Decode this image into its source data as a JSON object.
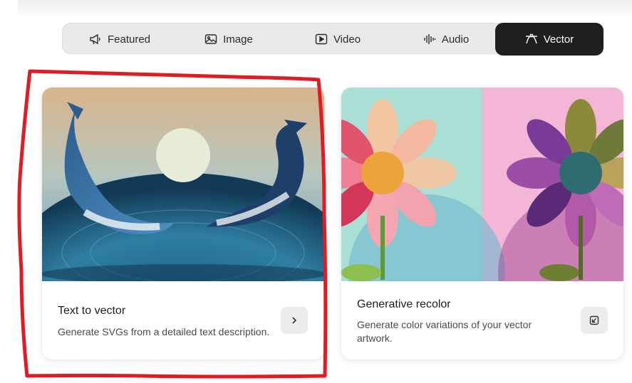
{
  "tabs": [
    {
      "label": "Featured",
      "icon": "megaphone-icon"
    },
    {
      "label": "Image",
      "icon": "image-icon"
    },
    {
      "label": "Video",
      "icon": "video-icon"
    },
    {
      "label": "Audio",
      "icon": "audio-waveform-icon"
    },
    {
      "label": "Vector",
      "icon": "vector-pen-icon",
      "active": true
    }
  ],
  "cards": [
    {
      "title": "Text to vector",
      "description": "Generate SVGs from a detailed text description.",
      "action_icon": "chevron-right-icon"
    },
    {
      "title": "Generative recolor",
      "description_line1": "Generate color variations of your vector",
      "description_line2": "artwork.",
      "action_icon": "open-arrow-icon"
    }
  ],
  "colors": {
    "active_tab_bg": "#1f1f1f",
    "tabbar_bg": "#e9e9e9",
    "annotation_red": "#e01b24"
  }
}
